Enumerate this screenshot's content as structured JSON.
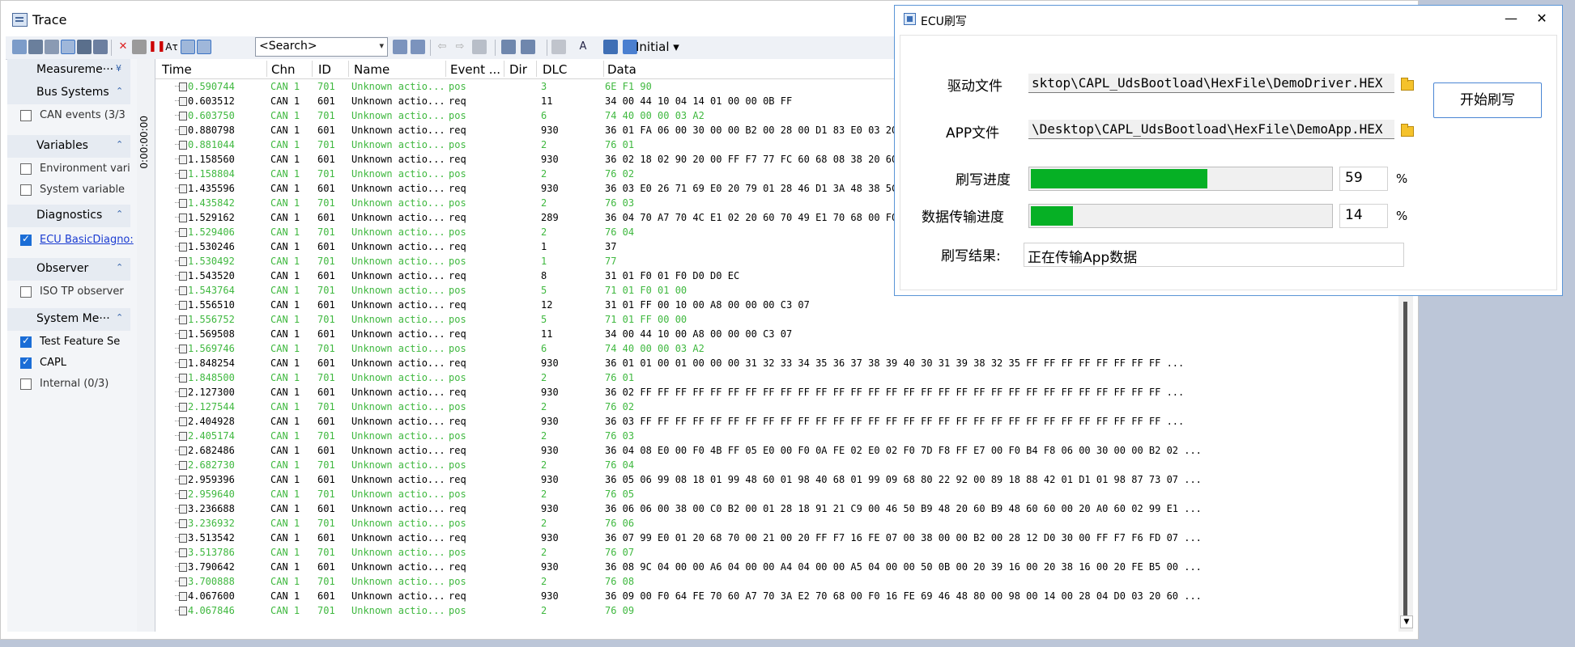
{
  "trace": {
    "title": "Trace",
    "search_placeholder": "<Search>",
    "initial_label": "Initial",
    "grip_text": "0:00:00:00",
    "columns": [
      "Time",
      "Chn",
      "ID",
      "Name",
      "Event ...",
      "Dir",
      "DLC",
      "Data"
    ],
    "sidebar": {
      "headers": [
        "Measureme···",
        "Bus Systems",
        "Variables",
        "Diagnostics",
        "Observer",
        "System Me···"
      ],
      "items": [
        {
          "label": "CAN events (3/3",
          "checked": false
        },
        {
          "label": "Environment vari",
          "checked": false
        },
        {
          "label": "System variable",
          "checked": false
        },
        {
          "label": "ECU BasicDiagno:",
          "checked": true
        },
        {
          "label": "ISO TP observer",
          "checked": false
        },
        {
          "label": "Test Feature Se",
          "checked": true
        },
        {
          "label": "CAPL",
          "checked": true
        },
        {
          "label": "Internal (0/3)",
          "checked": false
        }
      ]
    },
    "rows": [
      {
        "time": "0.590744",
        "chn": "CAN 1",
        "id": "701",
        "name": "Unknown actio...",
        "event": "pos",
        "dlc": "3",
        "data": "6E F1 90",
        "resp": true
      },
      {
        "time": "0.603512",
        "chn": "CAN 1",
        "id": "601",
        "name": "Unknown actio...",
        "event": "req",
        "dlc": "11",
        "data": "34 00 44 10 04 14 01 00 00 0B FF",
        "resp": false
      },
      {
        "time": "0.603750",
        "chn": "CAN 1",
        "id": "701",
        "name": "Unknown actio...",
        "event": "pos",
        "dlc": "6",
        "data": "74 40 00 00 03 A2",
        "resp": true
      },
      {
        "time": "0.880798",
        "chn": "CAN 1",
        "id": "601",
        "name": "Unknown actio...",
        "event": "req",
        "dlc": "930",
        "data": "36 01 FA 06 00 30 00 00 B2 00 28 00 D1 83 E0 03 20",
        "resp": false
      },
      {
        "time": "0.881044",
        "chn": "CAN 1",
        "id": "701",
        "name": "Unknown actio...",
        "event": "pos",
        "dlc": "2",
        "data": "76 01",
        "resp": true
      },
      {
        "time": "1.158560",
        "chn": "CAN 1",
        "id": "601",
        "name": "Unknown actio...",
        "event": "req",
        "dlc": "930",
        "data": "36 02 18 02 90 20 00 FF F7 77 FC 60 68 08 38 20 60",
        "resp": false
      },
      {
        "time": "1.158804",
        "chn": "CAN 1",
        "id": "701",
        "name": "Unknown actio...",
        "event": "pos",
        "dlc": "2",
        "data": "76 02",
        "resp": true
      },
      {
        "time": "1.435596",
        "chn": "CAN 1",
        "id": "601",
        "name": "Unknown actio...",
        "event": "req",
        "dlc": "930",
        "data": "36 03 E0 26 71 69 E0 20 79 01 28 46 D1 3A 48 38 5C",
        "resp": false
      },
      {
        "time": "1.435842",
        "chn": "CAN 1",
        "id": "701",
        "name": "Unknown actio...",
        "event": "pos",
        "dlc": "2",
        "data": "76 03",
        "resp": true
      },
      {
        "time": "1.529162",
        "chn": "CAN 1",
        "id": "601",
        "name": "Unknown actio...",
        "event": "req",
        "dlc": "289",
        "data": "36 04 70 A7 70 4C E1 02 20 60 70 49 E1 70 68 00 F0",
        "resp": false
      },
      {
        "time": "1.529406",
        "chn": "CAN 1",
        "id": "701",
        "name": "Unknown actio...",
        "event": "pos",
        "dlc": "2",
        "data": "76 04",
        "resp": true
      },
      {
        "time": "1.530246",
        "chn": "CAN 1",
        "id": "601",
        "name": "Unknown actio...",
        "event": "req",
        "dlc": "1",
        "data": "37",
        "resp": false
      },
      {
        "time": "1.530492",
        "chn": "CAN 1",
        "id": "701",
        "name": "Unknown actio...",
        "event": "pos",
        "dlc": "1",
        "data": "77",
        "resp": true
      },
      {
        "time": "1.543520",
        "chn": "CAN 1",
        "id": "601",
        "name": "Unknown actio...",
        "event": "req",
        "dlc": "8",
        "data": "31 01 F0 01 F0 D0 D0 EC",
        "resp": false
      },
      {
        "time": "1.543764",
        "chn": "CAN 1",
        "id": "701",
        "name": "Unknown actio...",
        "event": "pos",
        "dlc": "5",
        "data": "71 01 F0 01 00",
        "resp": true
      },
      {
        "time": "1.556510",
        "chn": "CAN 1",
        "id": "601",
        "name": "Unknown actio...",
        "event": "req",
        "dlc": "12",
        "data": "31 01 FF 00 10 00 A8 00 00 00 C3 07",
        "resp": false
      },
      {
        "time": "1.556752",
        "chn": "CAN 1",
        "id": "701",
        "name": "Unknown actio...",
        "event": "pos",
        "dlc": "5",
        "data": "71 01 FF 00 00",
        "resp": true
      },
      {
        "time": "1.569508",
        "chn": "CAN 1",
        "id": "601",
        "name": "Unknown actio...",
        "event": "req",
        "dlc": "11",
        "data": "34 00 44 10 00 A8 00 00 00 C3 07",
        "resp": false
      },
      {
        "time": "1.569746",
        "chn": "CAN 1",
        "id": "701",
        "name": "Unknown actio...",
        "event": "pos",
        "dlc": "6",
        "data": "74 40 00 00 03 A2",
        "resp": true
      },
      {
        "time": "1.848254",
        "chn": "CAN 1",
        "id": "601",
        "name": "Unknown actio...",
        "event": "req",
        "dlc": "930",
        "data": "36 01 01 00 01 00 00 00 31 32 33 34 35 36 37 38 39 40 30 31 39 38 32 35 FF FF FF FF FF FF FF FF  ...",
        "resp": false
      },
      {
        "time": "1.848500",
        "chn": "CAN 1",
        "id": "701",
        "name": "Unknown actio...",
        "event": "pos",
        "dlc": "2",
        "data": "76 01",
        "resp": true
      },
      {
        "time": "2.127300",
        "chn": "CAN 1",
        "id": "601",
        "name": "Unknown actio...",
        "event": "req",
        "dlc": "930",
        "data": "36 02 FF FF FF FF FF FF FF FF FF FF FF FF FF FF FF FF FF FF FF FF FF FF FF FF FF FF FF FF FF FF  ...",
        "resp": false
      },
      {
        "time": "2.127544",
        "chn": "CAN 1",
        "id": "701",
        "name": "Unknown actio...",
        "event": "pos",
        "dlc": "2",
        "data": "76 02",
        "resp": true
      },
      {
        "time": "2.404928",
        "chn": "CAN 1",
        "id": "601",
        "name": "Unknown actio...",
        "event": "req",
        "dlc": "930",
        "data": "36 03 FF FF FF FF FF FF FF FF FF FF FF FF FF FF FF FF FF FF FF FF FF FF FF FF FF FF FF FF FF FF  ...",
        "resp": false
      },
      {
        "time": "2.405174",
        "chn": "CAN 1",
        "id": "701",
        "name": "Unknown actio...",
        "event": "pos",
        "dlc": "2",
        "data": "76 03",
        "resp": true
      },
      {
        "time": "2.682486",
        "chn": "CAN 1",
        "id": "601",
        "name": "Unknown actio...",
        "event": "req",
        "dlc": "930",
        "data": "36 04 08 E0 00 F0 4B FF 05 E0 00 F0 0A FE 02 E0 02 F0 7D F8 FF E7 00 F0 B4 F8 06 00 30 00 00 B2 02  ...",
        "resp": false
      },
      {
        "time": "2.682730",
        "chn": "CAN 1",
        "id": "701",
        "name": "Unknown actio...",
        "event": "pos",
        "dlc": "2",
        "data": "76 04",
        "resp": true
      },
      {
        "time": "2.959396",
        "chn": "CAN 1",
        "id": "601",
        "name": "Unknown actio...",
        "event": "req",
        "dlc": "930",
        "data": "36 05 06 99 08 18 01 99 48 60 01 98 40 68 01 99 09 68 80 22 92 00 89 18 88 42 01 D1 01 98 87 73 07  ...",
        "resp": false
      },
      {
        "time": "2.959640",
        "chn": "CAN 1",
        "id": "701",
        "name": "Unknown actio...",
        "event": "pos",
        "dlc": "2",
        "data": "76 05",
        "resp": true
      },
      {
        "time": "3.236688",
        "chn": "CAN 1",
        "id": "601",
        "name": "Unknown actio...",
        "event": "req",
        "dlc": "930",
        "data": "36 06 06 00 38 00 C0 B2 00 01 28 18 91 21 C9 00 46 50 B9 48 20 60 B9 48 60 60 00 20 A0 60 02 99 E1  ...",
        "resp": false
      },
      {
        "time": "3.236932",
        "chn": "CAN 1",
        "id": "701",
        "name": "Unknown actio...",
        "event": "pos",
        "dlc": "2",
        "data": "76 06",
        "resp": true
      },
      {
        "time": "3.513542",
        "chn": "CAN 1",
        "id": "601",
        "name": "Unknown actio...",
        "event": "req",
        "dlc": "930",
        "data": "36 07 99 E0 01 20 68 70 00 21 00 20 FF F7 16 FE 07 00 38 00 00 B2 00 28 12 D0 30 00 FF F7 F6 FD 07  ...",
        "resp": false
      },
      {
        "time": "3.513786",
        "chn": "CAN 1",
        "id": "701",
        "name": "Unknown actio...",
        "event": "pos",
        "dlc": "2",
        "data": "76 07",
        "resp": true
      },
      {
        "time": "3.790642",
        "chn": "CAN 1",
        "id": "601",
        "name": "Unknown actio...",
        "event": "req",
        "dlc": "930",
        "data": "36 08 9C 04 00 00 A6 04 00 00 A4 04 00 00 A5 04 00 00 50 0B 00 20 39 16 00 20 38 16 00 20 FE B5 00  ...",
        "resp": false
      },
      {
        "time": "3.700888",
        "chn": "CAN 1",
        "id": "701",
        "name": "Unknown actio...",
        "event": "pos",
        "dlc": "2",
        "data": "76 08",
        "resp": true
      },
      {
        "time": "4.067600",
        "chn": "CAN 1",
        "id": "601",
        "name": "Unknown actio...",
        "event": "req",
        "dlc": "930",
        "data": "36 09 00 F0 64 FE 70 60 A7 70 3A E2 70 68 00 F0 16 FE 69 46 48 80 00 98 00 14 00 28 04 D0 03 20 60  ...",
        "resp": false
      },
      {
        "time": "4.067846",
        "chn": "CAN 1",
        "id": "701",
        "name": "Unknown actio...",
        "event": "pos",
        "dlc": "2",
        "data": "76 09",
        "resp": true
      }
    ]
  },
  "ecu": {
    "title": "ECU刷写",
    "driver_label": "驱动文件",
    "driver_path": "sktop\\CAPL_UdsBootload\\HexFile\\DemoDriver.HEX",
    "app_label": "APP文件",
    "app_path": "\\Desktop\\CAPL_UdsBootload\\HexFile\\DemoApp.HEX",
    "start_button": "开始刷写",
    "flash_progress_label": "刷写进度",
    "flash_progress_value": "59",
    "flash_progress_fraction": 0.59,
    "transfer_progress_label": "数据传输进度",
    "transfer_progress_value": "14",
    "transfer_progress_fraction": 0.14,
    "percent_sign": "%",
    "result_label": "刷写结果:",
    "result_text": "正在传输App数据"
  },
  "colors": {
    "response_row": "#3fb83f",
    "request_row": "#000000",
    "progress_fill": "#06b025",
    "dialog_border": "#5a95d6"
  }
}
